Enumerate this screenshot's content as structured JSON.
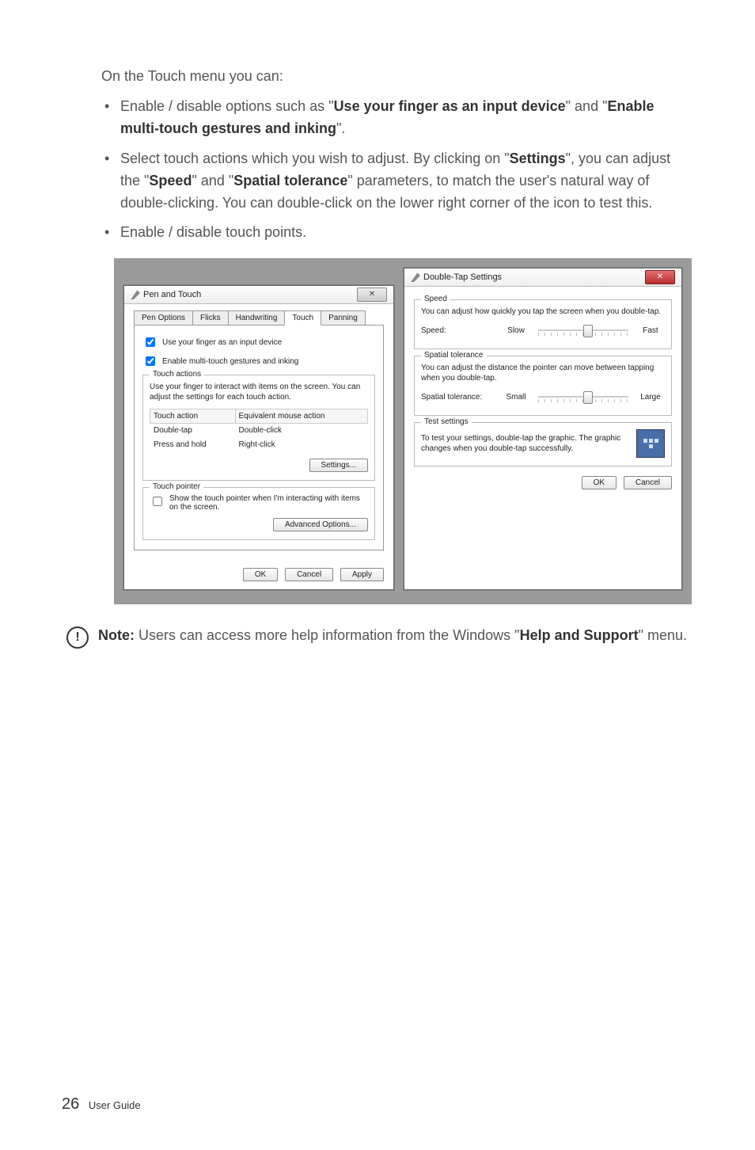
{
  "intro": "On the Touch menu you can:",
  "bullets": [
    {
      "pre": "Enable / disable options such as \"",
      "b1": "Use your finger as an input device",
      "mid": "\" and \"",
      "b2": "Enable multi-touch gestures and inking",
      "post": "\"."
    },
    {
      "pre": "Select touch actions which you wish to adjust. By clicking on \"",
      "b1": "Settings",
      "mid": "\", you can adjust the \"",
      "b2": "Speed",
      "mid2": "\" and \"",
      "b3": "Spatial tolerance",
      "post": "\" parameters, to match the user's natural way of double-clicking. You can double-click on the lower right corner of the icon to test this."
    },
    {
      "pre": "Enable / disable touch points."
    }
  ],
  "dlg_left": {
    "title": "Pen and Touch",
    "tabs": [
      "Pen Options",
      "Flicks",
      "Handwriting",
      "Touch",
      "Panning"
    ],
    "active_tab_index": 3,
    "chk1": "Use your finger as an input device",
    "chk2": "Enable multi-touch gestures and inking",
    "touch_actions": {
      "legend": "Touch actions",
      "desc": "Use your finger to interact with items on the screen. You can adjust the settings for each touch action.",
      "header1": "Touch action",
      "header2": "Equivalent mouse action",
      "rows": [
        [
          "Double-tap",
          "Double-click"
        ],
        [
          "Press and hold",
          "Right-click"
        ]
      ],
      "settings_btn": "Settings..."
    },
    "touch_pointer": {
      "legend": "Touch pointer",
      "chk": "Show the touch pointer when I'm interacting with items on the screen.",
      "adv_btn": "Advanced Options..."
    },
    "footer": {
      "ok": "OK",
      "cancel": "Cancel",
      "apply": "Apply"
    }
  },
  "dlg_right": {
    "title": "Double-Tap Settings",
    "speed": {
      "legend": "Speed",
      "desc": "You can adjust how quickly you tap the screen when you double-tap.",
      "label": "Speed:",
      "min": "Slow",
      "max": "Fast"
    },
    "spatial": {
      "legend": "Spatial tolerance",
      "desc": "You can adjust the distance the pointer can move between tapping when you double-tap.",
      "label": "Spatial tolerance:",
      "min": "Small",
      "max": "Large"
    },
    "test": {
      "legend": "Test settings",
      "desc": "To test your settings, double-tap the graphic. The graphic changes when you double-tap successfully."
    },
    "footer": {
      "ok": "OK",
      "cancel": "Cancel"
    }
  },
  "note": {
    "label": "Note:",
    "pre": " Users can access more help information from the Windows \"",
    "b": "Help and Support",
    "post": "\" menu."
  },
  "footer": {
    "page": "26",
    "label": "User Guide"
  }
}
